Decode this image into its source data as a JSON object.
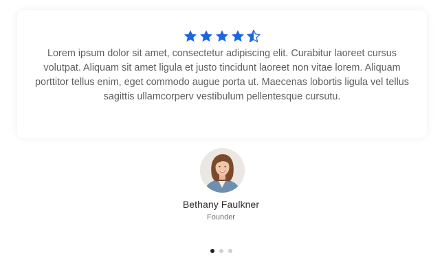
{
  "testimonial": {
    "rating": 4.5,
    "rating_max": 5,
    "quote": "Lorem ipsum dolor sit amet, consectetur adipiscing elit. Curabitur laoreet cursus volutpat. Aliquam sit amet ligula et justo tincidunt laoreet non vitae lorem. Aliquam porttitor tellus enim, eget commodo augue porta ut. Maecenas lobortis ligula vel tellus sagittis ullamcorperv vestibulum pellentesque cursutu.",
    "author_name": "Bethany Faulkner",
    "author_role": "Founder"
  },
  "carousel": {
    "slide_count": 3,
    "active_index": 0
  },
  "colors": {
    "star": "#1a66e0",
    "dot_active": "#222222",
    "dot_inactive": "#cfcfcf"
  },
  "icons": {
    "star": "star-icon",
    "half_star": "star-half-icon"
  }
}
